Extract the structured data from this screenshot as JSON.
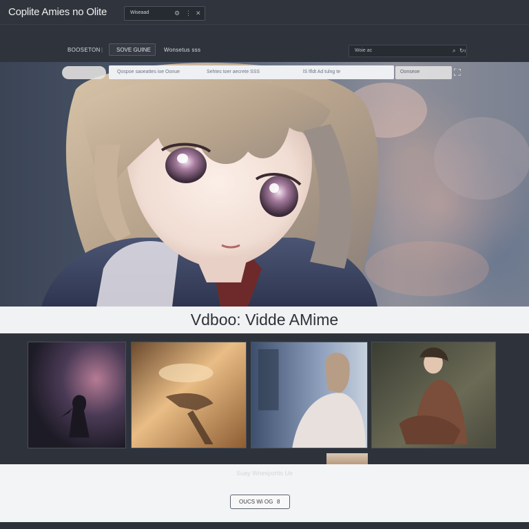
{
  "app": {
    "title": "Coplite Amies no Olite"
  },
  "top_search": {
    "value": "Wiseaad ",
    "icons": [
      "settings-icon",
      "menu-icon",
      "close-icon"
    ]
  },
  "nav": {
    "items": [
      {
        "label": "BOOSETON",
        "active": false
      },
      {
        "label": "SOVE GUINE",
        "active": true
      },
      {
        "label": "Wonsetus sss",
        "active": false
      }
    ],
    "separator": "|",
    "search": {
      "value": "Woie ac",
      "icons": [
        "search-icon",
        "refresh-icon",
        "info-icon"
      ]
    }
  },
  "hero": {
    "filter_items": [
      "Qospoe saoeattes ioe Oonue",
      "Sehtes toer aecrete SSS",
      "lS lfldt Ad tulng te"
    ],
    "right_pill": "Oonseoe",
    "corner_icon": "fullscreen-icon"
  },
  "title": "Vdboo: Vidde AMime",
  "thumbnails": [
    {
      "name": "thumb-dark-figure"
    },
    {
      "name": "thumb-golden-scene"
    },
    {
      "name": "thumb-window-girl"
    },
    {
      "name": "thumb-sitting-boy"
    }
  ],
  "footer": {
    "caption": "Suay Woesportis Ue",
    "button_label": "OUCS Wi OG",
    "button_suffix": "8"
  },
  "colors": {
    "background": "#2c3139",
    "strip": "#f1f2f3",
    "title_text": "#2e3238"
  }
}
